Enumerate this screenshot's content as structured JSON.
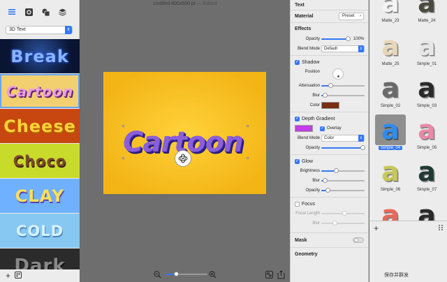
{
  "left": {
    "style_select": "3D Text",
    "presets": [
      {
        "key": "break",
        "label": "Break"
      },
      {
        "key": "cartoon",
        "label": "Cartoon"
      },
      {
        "key": "cheese",
        "label": "Cheese"
      },
      {
        "key": "choco",
        "label": "Choco"
      },
      {
        "key": "clay",
        "label": "CLAY"
      },
      {
        "key": "cold",
        "label": "COLD"
      },
      {
        "key": "dark",
        "label": "Dark"
      }
    ]
  },
  "canvas": {
    "doc_title": "Untitled 800x600 pt",
    "doc_status": "— Edited",
    "art_text": "Cartoon",
    "zoom_level": 0.25
  },
  "props": {
    "text_header": "Text",
    "material_label": "Material",
    "preset_button": "Preset",
    "effects_header": "Effects",
    "opacity_label": "Opacity",
    "opacity_value": "100%",
    "blend_mode_label": "Blend Mode",
    "blend_mode_value": "Default",
    "shadow_label": "Shadow",
    "position_label": "Position",
    "attenuation_label": "Attenuation",
    "blur_label": "Blur",
    "color_label": "Color",
    "shadow_color": "#7a2e12",
    "depth_gradient_label": "Depth Gradient",
    "depth_color": "#c23ee6",
    "overlay_label": "Overlay",
    "depth_blend_label": "Blend Mode",
    "depth_blend_value": "Color",
    "depth_opacity_label": "Opacity",
    "glow_label": "Glow",
    "brightness_label": "Brightness",
    "glow_blur_label": "Blur",
    "glow_opacity_label": "Opacity",
    "focus_label": "Focus",
    "focal_length_label": "Focal Length",
    "focus_blur_label": "Blur",
    "mask_label": "Mask",
    "geometry_label": "Geometry"
  },
  "styles": {
    "items": [
      {
        "name": "Matte_23",
        "color": "#f4f4f4"
      },
      {
        "name": "Matte_24",
        "color": "#4a4a3e"
      },
      {
        "name": "Matte_25",
        "color": "#e8d6b8"
      },
      {
        "name": "Simple_01",
        "color": "#e6e6e6"
      },
      {
        "name": "Simple_02",
        "color": "#6a6a6a"
      },
      {
        "name": "Simple_03",
        "color": "#2a2a2a"
      },
      {
        "name": "Simple_04",
        "color": "#2f8cf0"
      },
      {
        "name": "Simple_05",
        "color": "#e88aa8"
      },
      {
        "name": "Simple_06",
        "color": "#c8c85a"
      },
      {
        "name": "Simple_07",
        "color": "#1f3a32"
      },
      {
        "name": "",
        "color": "#e8695a"
      },
      {
        "name": "",
        "color": "#2a2a2a"
      }
    ],
    "save_button": "保存并群发"
  }
}
